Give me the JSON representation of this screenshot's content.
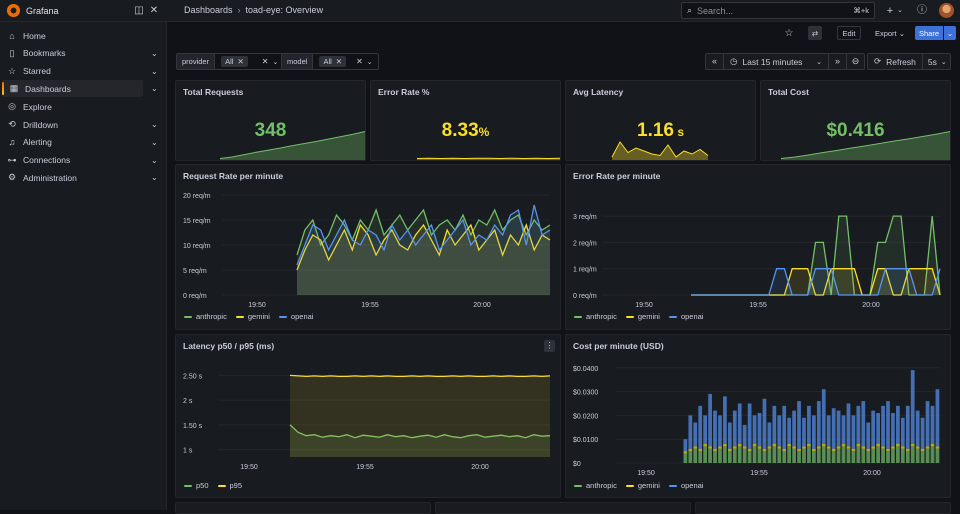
{
  "app": {
    "name": "Grafana"
  },
  "breadcrumbs": {
    "root": "Dashboards",
    "separator": "›",
    "current": "toad-eye: Overview"
  },
  "search": {
    "placeholder": "Search...",
    "shortcut": "⌘+k"
  },
  "sidebar": {
    "items": [
      {
        "label": "Home",
        "icon": "home-icon",
        "glyph": "⌂",
        "chevron": false
      },
      {
        "label": "Bookmarks",
        "icon": "bookmark-icon",
        "glyph": "▯",
        "chevron": true
      },
      {
        "label": "Starred",
        "icon": "star-icon",
        "glyph": "☆",
        "chevron": true
      },
      {
        "label": "Dashboards",
        "icon": "grid-icon",
        "glyph": "▦",
        "chevron": true,
        "active": true
      },
      {
        "label": "Explore",
        "icon": "compass-icon",
        "glyph": "◎",
        "chevron": false
      },
      {
        "label": "Drilldown",
        "icon": "drilldown-icon",
        "glyph": "⟲",
        "chevron": true
      },
      {
        "label": "Alerting",
        "icon": "bell-icon",
        "glyph": "♫",
        "chevron": true
      },
      {
        "label": "Connections",
        "icon": "connections-icon",
        "glyph": "⊶",
        "chevron": true
      },
      {
        "label": "Administration",
        "icon": "gear-icon",
        "glyph": "⚙",
        "chevron": true
      }
    ]
  },
  "toolbar": {
    "edit": "Edit",
    "export": "Export",
    "share": "Share",
    "refresh": "Refresh",
    "interval": "5s",
    "time_range": "Last 15 minutes"
  },
  "variables": [
    {
      "label": "provider",
      "value": "All"
    },
    {
      "label": "model",
      "value": "All"
    }
  ],
  "colors": {
    "green": "#73bf69",
    "yellow": "#fade2a",
    "blue": "#5794f2",
    "accent": "#3d71d9"
  },
  "stats": [
    {
      "title": "Total Requests",
      "value": "348",
      "unit": "",
      "color": "#73bf69"
    },
    {
      "title": "Error Rate %",
      "value": "8.33",
      "unit": "%",
      "color": "#fade2a"
    },
    {
      "title": "Avg Latency",
      "value": "1.16",
      "unit": " s",
      "color": "#fade2a"
    },
    {
      "title": "Total Cost",
      "value": "$0.416",
      "unit": "",
      "color": "#73bf69"
    }
  ],
  "chart_data": [
    {
      "type": "line",
      "title": "Request Rate per minute",
      "x": [
        "19:50",
        "19:55",
        "20:00"
      ],
      "y_ticks": [
        "0 req/m",
        "5 req/m",
        "10 req/m",
        "15 req/m",
        "20 req/m"
      ],
      "ylim": [
        0,
        20
      ],
      "series": [
        {
          "name": "anthropic",
          "color": "#73bf69",
          "values": [
            8,
            13,
            15,
            10,
            12,
            16,
            14,
            11,
            15,
            13,
            17,
            12,
            14,
            16,
            13,
            15,
            17,
            12,
            14,
            15,
            13,
            16,
            12,
            15,
            14,
            17,
            13,
            15,
            16,
            12,
            15,
            13,
            14
          ]
        },
        {
          "name": "gemini",
          "color": "#fade2a",
          "values": [
            5,
            9,
            12,
            11,
            7,
            10,
            13,
            9,
            14,
            12,
            8,
            11,
            13,
            10,
            9,
            12,
            14,
            11,
            8,
            13,
            10,
            12,
            14,
            9,
            11,
            13,
            8,
            12,
            10,
            14,
            9,
            12,
            11
          ]
        },
        {
          "name": "openai",
          "color": "#5794f2",
          "values": [
            6,
            10,
            14,
            13,
            9,
            12,
            15,
            11,
            10,
            13,
            12,
            9,
            14,
            11,
            13,
            10,
            12,
            14,
            9,
            11,
            13,
            15,
            10,
            12,
            11,
            14,
            12,
            16,
            17,
            10,
            18,
            12,
            13
          ]
        }
      ]
    },
    {
      "type": "line",
      "title": "Error Rate per minute",
      "x": [
        "19:50",
        "19:55",
        "20:00"
      ],
      "y_ticks": [
        "0 req/m",
        "1 req/m",
        "2 req/m",
        "3 req/m"
      ],
      "ylim": [
        0,
        3.5
      ],
      "series": [
        {
          "name": "anthropic",
          "color": "#73bf69",
          "values": [
            0,
            0,
            0,
            0,
            0,
            0,
            0,
            0,
            0,
            0,
            0,
            0,
            0,
            0,
            0,
            0,
            2,
            2,
            0,
            3,
            3,
            0,
            0,
            0,
            2,
            2,
            3,
            3,
            0,
            0,
            0,
            3,
            0
          ]
        },
        {
          "name": "gemini",
          "color": "#fade2a",
          "values": [
            0,
            0,
            0,
            0,
            0,
            0,
            0,
            0,
            0,
            0,
            0,
            0,
            0,
            1,
            1,
            1,
            0,
            0,
            1,
            1,
            1,
            1,
            0,
            0,
            1,
            1,
            0,
            0,
            1,
            1,
            1,
            1,
            0
          ]
        },
        {
          "name": "openai",
          "color": "#5794f2",
          "values": [
            0,
            0,
            0,
            0,
            0,
            0,
            0,
            0,
            0,
            0,
            0,
            1,
            1,
            0,
            0,
            0,
            1,
            1,
            1,
            0,
            0,
            0,
            0,
            0,
            0,
            1,
            1,
            1,
            1,
            0,
            0,
            0,
            1
          ]
        }
      ]
    },
    {
      "type": "line",
      "title": "Latency p50 / p95 (ms)",
      "x": [
        "19:50",
        "19:55",
        "20:00"
      ],
      "y_ticks": [
        "1 s",
        "1.50 s",
        "2 s",
        "2.50 s"
      ],
      "ylim": [
        0.85,
        2.75
      ],
      "series": [
        {
          "name": "p50",
          "color": "#73bf69",
          "values": [
            1.5,
            1.35,
            1.28,
            1.3,
            1.25,
            1.28,
            1.26,
            1.3,
            1.24,
            1.29,
            1.27,
            1.25,
            1.3,
            1.26,
            1.28,
            1.24,
            1.27,
            1.29,
            1.25,
            1.3,
            1.26,
            1.24,
            1.28,
            1.3,
            1.25,
            1.27,
            1.29,
            1.26,
            1.28,
            1.24,
            1.3,
            1.27,
            1.28
          ]
        },
        {
          "name": "p95",
          "color": "#fade2a",
          "values": [
            2.5,
            2.49,
            2.48,
            2.49,
            2.48,
            2.49,
            2.48,
            2.48,
            2.49,
            2.48,
            2.49,
            2.48,
            2.49,
            2.48,
            2.48,
            2.49,
            2.48,
            2.49,
            2.48,
            2.48,
            2.49,
            2.48,
            2.49,
            2.48,
            2.48,
            2.49,
            2.48,
            2.49,
            2.48,
            2.48,
            2.49,
            2.48,
            2.49
          ]
        }
      ]
    },
    {
      "type": "bar",
      "title": "Cost per minute (USD)",
      "x": [
        "19:50",
        "19:55",
        "20:00"
      ],
      "y_ticks": [
        "$0",
        "$0.0100",
        "$0.0200",
        "$0.0300",
        "$0.0400"
      ],
      "ylim": [
        0,
        0.042
      ],
      "series": [
        {
          "name": "anthropic",
          "color": "#73bf69",
          "values": [
            0.004,
            0.005,
            0.006,
            0.005,
            0.007,
            0.006,
            0.005,
            0.006,
            0.007,
            0.005,
            0.006,
            0.007,
            0.006,
            0.005,
            0.007,
            0.006,
            0.005,
            0.006,
            0.007,
            0.006,
            0.005,
            0.007,
            0.006,
            0.005,
            0.006,
            0.007,
            0.005,
            0.006,
            0.007,
            0.006,
            0.005,
            0.006,
            0.007,
            0.006,
            0.005,
            0.007,
            0.006,
            0.005,
            0.006,
            0.007,
            0.006,
            0.005,
            0.006,
            0.007,
            0.006,
            0.005,
            0.007,
            0.006,
            0.005,
            0.006,
            0.007,
            0.006
          ]
        },
        {
          "name": "gemini",
          "color": "#fade2a",
          "values": [
            0.001,
            0.001,
            0.001,
            0.001,
            0.001,
            0.001,
            0.001,
            0.001,
            0.001,
            0.001,
            0.001,
            0.001,
            0.001,
            0.001,
            0.001,
            0.001,
            0.001,
            0.001,
            0.001,
            0.001,
            0.001,
            0.001,
            0.001,
            0.001,
            0.001,
            0.001,
            0.001,
            0.001,
            0.001,
            0.001,
            0.001,
            0.001,
            0.001,
            0.001,
            0.001,
            0.001,
            0.001,
            0.001,
            0.001,
            0.001,
            0.001,
            0.001,
            0.001,
            0.001,
            0.001,
            0.001,
            0.001,
            0.001,
            0.001,
            0.001,
            0.001,
            0.001
          ]
        },
        {
          "name": "openai",
          "color": "#5794f2",
          "values": [
            0.005,
            0.014,
            0.01,
            0.018,
            0.012,
            0.022,
            0.016,
            0.013,
            0.02,
            0.011,
            0.015,
            0.017,
            0.009,
            0.019,
            0.012,
            0.014,
            0.021,
            0.01,
            0.016,
            0.013,
            0.018,
            0.011,
            0.015,
            0.02,
            0.012,
            0.016,
            0.014,
            0.019,
            0.023,
            0.013,
            0.017,
            0.015,
            0.012,
            0.018,
            0.014,
            0.016,
            0.019,
            0.011,
            0.015,
            0.013,
            0.017,
            0.02,
            0.014,
            0.016,
            0.012,
            0.018,
            0.031,
            0.015,
            0.013,
            0.019,
            0.016,
            0.024
          ]
        }
      ]
    }
  ]
}
